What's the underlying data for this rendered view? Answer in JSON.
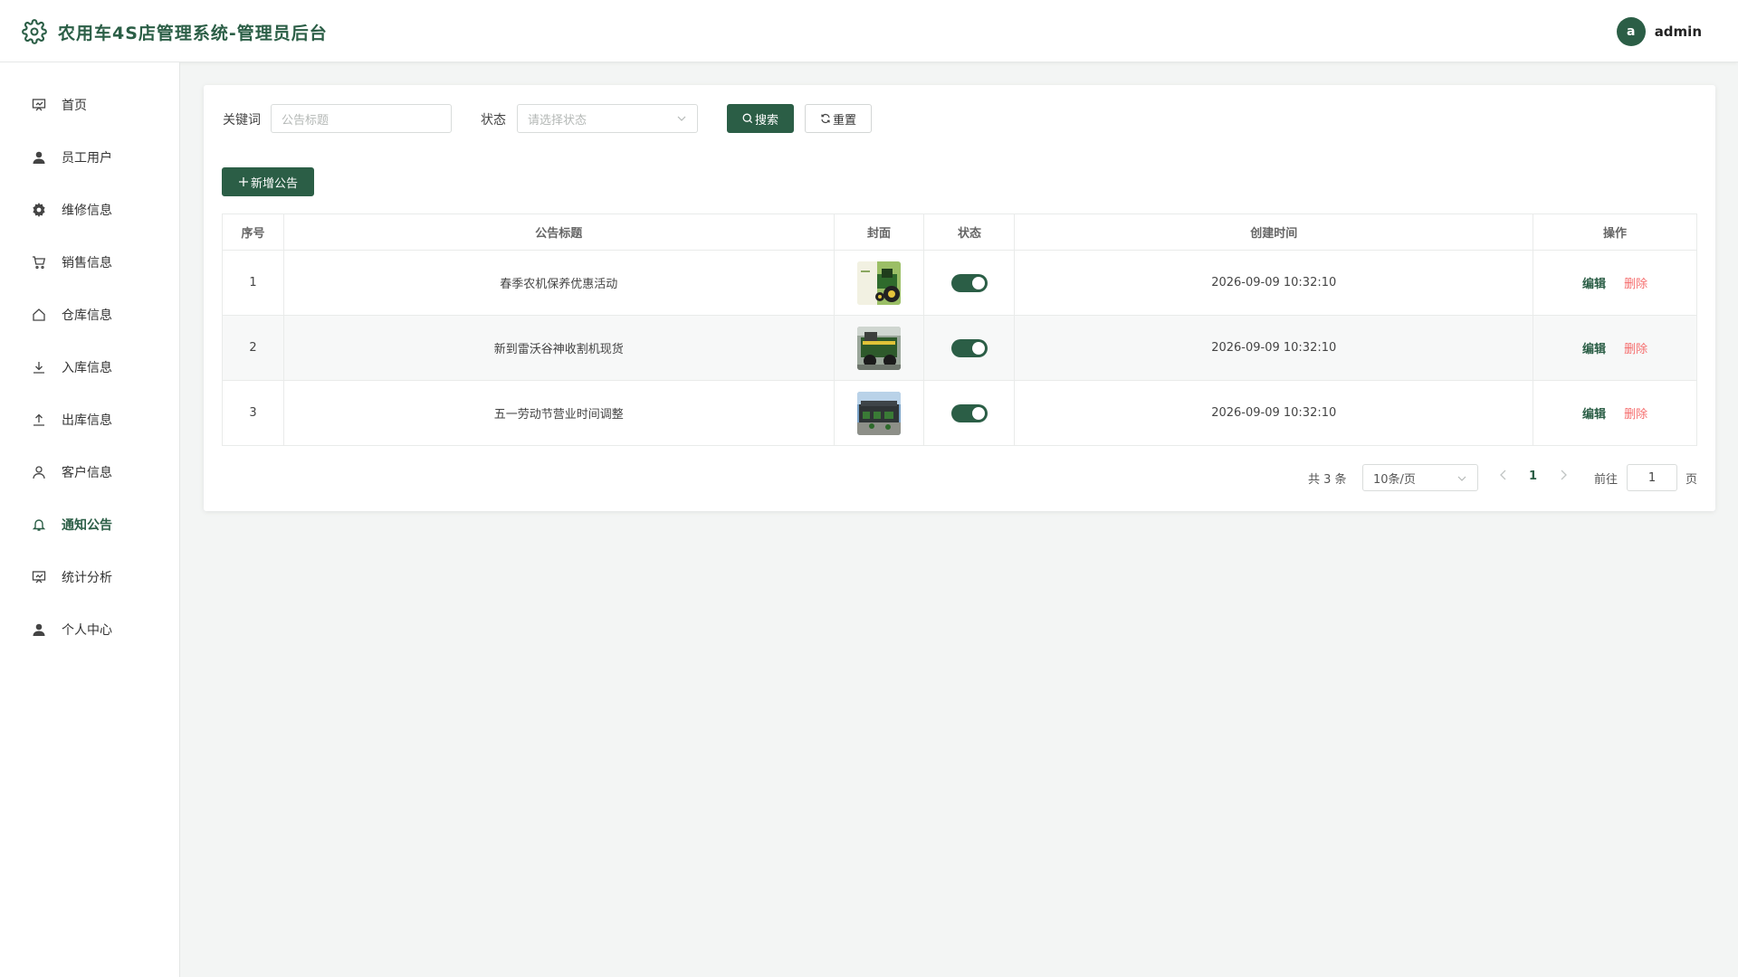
{
  "header": {
    "title": "农用车4S店管理系统-管理员后台",
    "avatar_letter": "a",
    "username": "admin"
  },
  "sidebar": {
    "items": [
      {
        "label": "首页",
        "icon": "dashboard-icon"
      },
      {
        "label": "员工用户",
        "icon": "user-icon"
      },
      {
        "label": "维修信息",
        "icon": "gear-icon"
      },
      {
        "label": "销售信息",
        "icon": "cart-icon"
      },
      {
        "label": "仓库信息",
        "icon": "house-icon"
      },
      {
        "label": "入库信息",
        "icon": "download-icon"
      },
      {
        "label": "出库信息",
        "icon": "upload-icon"
      },
      {
        "label": "客户信息",
        "icon": "user-outline-icon"
      },
      {
        "label": "通知公告",
        "icon": "bell-icon",
        "active": true
      },
      {
        "label": "统计分析",
        "icon": "chart-icon"
      },
      {
        "label": "个人中心",
        "icon": "user-icon"
      }
    ]
  },
  "filters": {
    "keyword_label": "关键词",
    "keyword_placeholder": "公告标题",
    "status_label": "状态",
    "status_placeholder": "请选择状态",
    "search_label": "搜索",
    "reset_label": "重置",
    "add_label": "新增公告"
  },
  "table": {
    "headers": [
      "序号",
      "公告标题",
      "封面",
      "状态",
      "创建时间",
      "操作"
    ],
    "rows": [
      {
        "index": "1",
        "title": "春季农机保养优惠活动",
        "cover": "tractor-green",
        "enabled": true,
        "created": "2026-09-09 10:32:10"
      },
      {
        "index": "2",
        "title": "新到雷沃谷神收割机现货",
        "cover": "harvester",
        "enabled": true,
        "created": "2026-09-09 10:32:10"
      },
      {
        "index": "3",
        "title": "五一劳动节营业时间调整",
        "cover": "dealership",
        "enabled": true,
        "created": "2026-09-09 10:32:10"
      }
    ],
    "edit_label": "编辑",
    "delete_label": "删除"
  },
  "pagination": {
    "total_label": "共 3 条",
    "page_size_label": "10条/页",
    "current_page": "1",
    "goto_label": "前往",
    "goto_value": "1",
    "page_suffix": "页"
  },
  "colors": {
    "brand": "#2b5e46",
    "danger": "#f56c6c",
    "background": "#f3f5f4"
  }
}
